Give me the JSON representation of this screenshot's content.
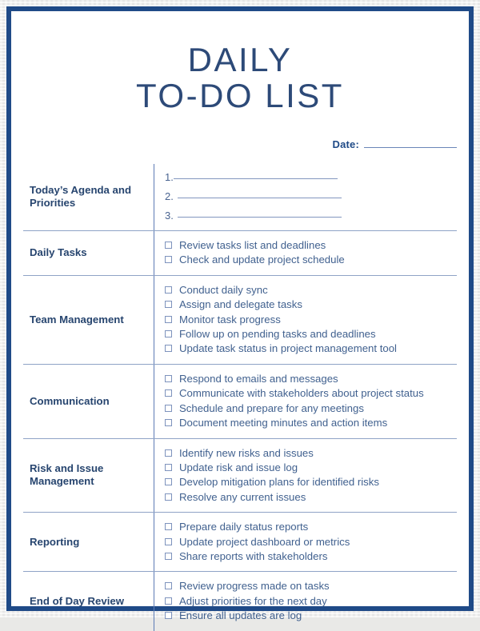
{
  "document": {
    "title_line_1": "DAILY",
    "title_line_2": "TO-DO LIST",
    "date_label": "Date:",
    "date_value": ""
  },
  "colors": {
    "frame": "#1f4a87",
    "title": "#2d4a78",
    "label": "#27456f",
    "body_text": "#41618f",
    "rule": "#8fa3c6"
  },
  "sections": [
    {
      "label": "Today’s Agenda and Priorities",
      "type": "numbered_blanks",
      "items": [
        {
          "number": "1.",
          "value": ""
        },
        {
          "number": "2.",
          "value": ""
        },
        {
          "number": "3.",
          "value": ""
        }
      ]
    },
    {
      "label": "Daily Tasks",
      "type": "checklist",
      "items": [
        "Review tasks list and deadlines",
        "Check and update project schedule"
      ]
    },
    {
      "label": "Team Management",
      "type": "checklist",
      "items": [
        "Conduct daily sync",
        "Assign and delegate tasks",
        "Monitor task progress",
        "Follow up on pending tasks and deadlines",
        "Update task status in project management tool"
      ]
    },
    {
      "label": "Communication",
      "type": "checklist",
      "items": [
        "Respond to emails and messages",
        "Communicate with stakeholders about project status",
        "Schedule and prepare for any meetings",
        "Document meeting minutes and action items"
      ]
    },
    {
      "label": "Risk and Issue Management",
      "type": "checklist",
      "items": [
        "Identify new risks and issues",
        "Update risk and issue log",
        "Develop mitigation plans for identified risks",
        "Resolve any current issues"
      ]
    },
    {
      "label": "Reporting",
      "type": "checklist",
      "items": [
        "Prepare daily status reports",
        "Update project dashboard or metrics",
        "Share reports with stakeholders"
      ]
    },
    {
      "label": "End of Day Review",
      "type": "checklist",
      "items": [
        "Review progress made on tasks",
        "Adjust priorities for the next day",
        "Ensure all updates are log"
      ]
    }
  ]
}
